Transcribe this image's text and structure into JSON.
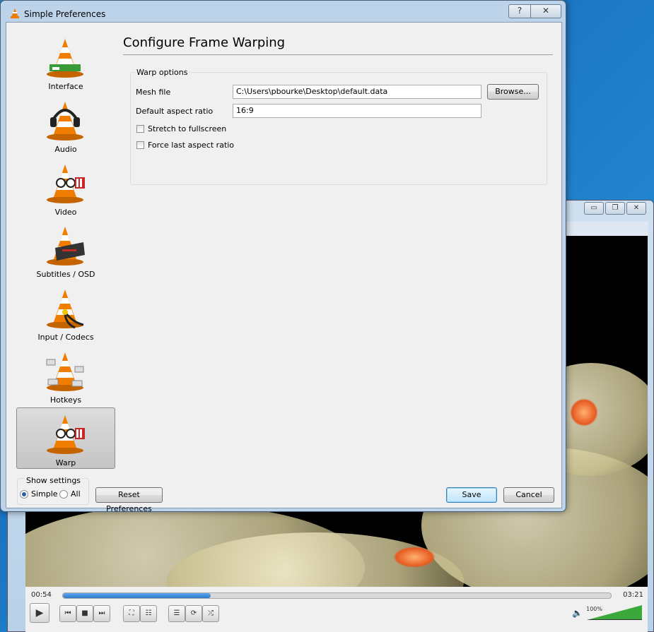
{
  "dialog": {
    "title": "Simple Preferences",
    "help_glyph": "?",
    "close_glyph": "✕",
    "heading": "Configure Frame Warping"
  },
  "sidebar": {
    "items": [
      {
        "label": "Interface",
        "icon": "vlc-cone-interface-icon",
        "selected": false
      },
      {
        "label": "Audio",
        "icon": "vlc-cone-headphones-icon",
        "selected": false
      },
      {
        "label": "Video",
        "icon": "vlc-cone-glasses-icon",
        "selected": false
      },
      {
        "label": "Subtitles / OSD",
        "icon": "vlc-cone-subtitles-icon",
        "selected": false
      },
      {
        "label": "Input / Codecs",
        "icon": "vlc-cone-cables-icon",
        "selected": false
      },
      {
        "label": "Hotkeys",
        "icon": "vlc-cone-keys-icon",
        "selected": false
      },
      {
        "label": "Warp",
        "icon": "vlc-cone-glasses-icon",
        "selected": true
      }
    ]
  },
  "warp_options": {
    "group_title": "Warp options",
    "mesh_file_label": "Mesh file",
    "mesh_file_value": "C:\\Users\\pbourke\\Desktop\\default.data",
    "browse_label": "Browse...",
    "aspect_label": "Default aspect ratio",
    "aspect_value": "16:9",
    "stretch_label": "Stretch to fullscreen",
    "stretch_checked": false,
    "force_label": "Force last aspect ratio",
    "force_checked": false
  },
  "show_settings": {
    "title": "Show settings",
    "simple_label": "Simple",
    "all_label": "All",
    "selected": "Simple"
  },
  "footer": {
    "reset_label": "Reset Preferences",
    "save_label": "Save",
    "cancel_label": "Cancel"
  },
  "player": {
    "elapsed": "00:54",
    "total": "03:21",
    "progress": 0.27,
    "volume_label": "100%",
    "volume": 1.0,
    "window_buttons": [
      "▭",
      "❐",
      "✕"
    ]
  },
  "colors": {
    "accent": "#2f79c7",
    "vlc_orange": "#f07d00",
    "volume_green": "#3aa83a"
  }
}
